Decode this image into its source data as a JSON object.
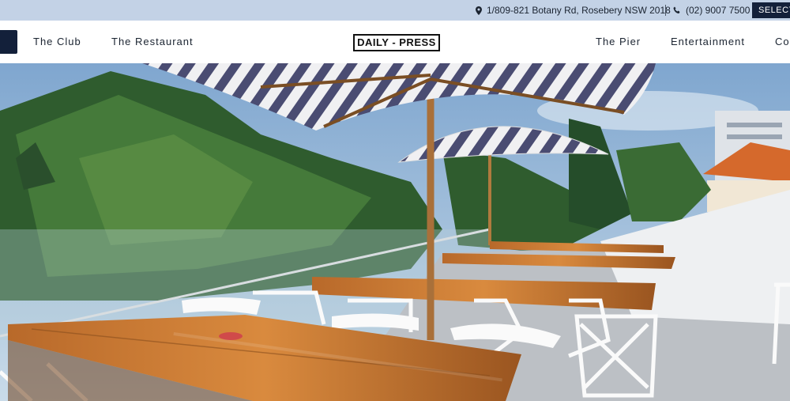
{
  "topbar": {
    "address": "1/809-821 Botany Rd, Rosebery NSW 2018",
    "phone": "(02) 9007 7500",
    "select_label": "SELECT"
  },
  "nav": {
    "left": [
      "The Club",
      "The Restaurant"
    ],
    "logo": "DAILY - PRESS",
    "right": [
      "The Pier",
      "Entertainment",
      "Co"
    ]
  },
  "colors": {
    "topbar_bg": "#c3d2e6",
    "accent_navy": "#13203a"
  }
}
